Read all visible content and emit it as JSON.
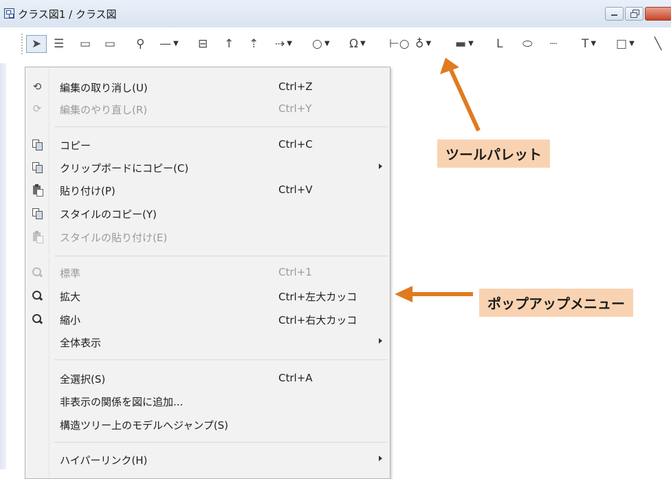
{
  "window": {
    "title": "クラス図1 / クラス図"
  },
  "toolbar": {
    "tools": [
      {
        "icon": "select-arrow-icon",
        "glyph": "➤"
      },
      {
        "icon": "class-icon",
        "glyph": "☰"
      },
      {
        "icon": "package-icon",
        "glyph": "▭"
      },
      {
        "icon": "subsystem-icon",
        "glyph": "▭"
      },
      {
        "icon": "pin-icon",
        "glyph": "⚲"
      },
      {
        "icon": "association-icon",
        "glyph": "—",
        "dropdown": true
      },
      {
        "icon": "association-class-icon",
        "glyph": "⊟"
      },
      {
        "icon": "generalization-icon",
        "glyph": "↑"
      },
      {
        "icon": "realization-icon",
        "glyph": "⇡"
      },
      {
        "icon": "dependency-icon",
        "glyph": "⇢",
        "dropdown": true
      },
      {
        "icon": "usage-icon",
        "glyph": "○",
        "dropdown": true
      },
      {
        "icon": "omega-icon",
        "glyph": "Ω",
        "dropdown": true
      },
      {
        "icon": "interface-icon",
        "glyph": "⊢○"
      },
      {
        "icon": "provided-interface-icon",
        "glyph": "♁",
        "dropdown": true
      },
      {
        "icon": "component-icon",
        "glyph": "▬",
        "dropdown": true
      },
      {
        "icon": "constraint-icon",
        "glyph": "L"
      },
      {
        "icon": "note-icon",
        "glyph": "⬭"
      },
      {
        "icon": "note-anchor-icon",
        "glyph": "┈"
      },
      {
        "icon": "text-icon",
        "glyph": "T",
        "dropdown": true
      },
      {
        "icon": "rectangle-icon",
        "glyph": "□",
        "dropdown": true
      },
      {
        "icon": "line-icon",
        "glyph": "╲"
      }
    ]
  },
  "menu": {
    "items": [
      {
        "label": "編集の取り消し(U)",
        "shortcut": "Ctrl+Z",
        "icon": "undo-icon",
        "enabled": true
      },
      {
        "label": "編集のやり直し(R)",
        "shortcut": "Ctrl+Y",
        "icon": "redo-icon",
        "enabled": false
      },
      {
        "label": "コピー",
        "shortcut": "Ctrl+C",
        "icon": "copy-icon",
        "enabled": true
      },
      {
        "label": "クリップボードにコピー(C)",
        "shortcut": "",
        "icon": "copy-clipboard-icon",
        "enabled": true,
        "submenu": true
      },
      {
        "label": "貼り付け(P)",
        "shortcut": "Ctrl+V",
        "icon": "paste-icon",
        "enabled": true
      },
      {
        "label": "スタイルのコピー(Y)",
        "shortcut": "",
        "icon": "copy-style-icon",
        "enabled": true
      },
      {
        "label": "スタイルの貼り付け(E)",
        "shortcut": "",
        "icon": "paste-style-icon",
        "enabled": false
      },
      {
        "label": "標準",
        "shortcut": "Ctrl+1",
        "icon": "zoom-normal-icon",
        "enabled": false
      },
      {
        "label": "拡大",
        "shortcut": "Ctrl+左大カッコ",
        "icon": "zoom-in-icon",
        "enabled": true
      },
      {
        "label": "縮小",
        "shortcut": "Ctrl+右大カッコ",
        "icon": "zoom-out-icon",
        "enabled": true
      },
      {
        "label": "全体表示",
        "shortcut": "",
        "icon": "",
        "enabled": true,
        "submenu": true
      },
      {
        "label": "全選択(S)",
        "shortcut": "Ctrl+A",
        "icon": "",
        "enabled": true
      },
      {
        "label": "非表示の関係を図に追加...",
        "shortcut": "",
        "icon": "",
        "enabled": true
      },
      {
        "label": "構造ツリー上のモデルへジャンプ(S)",
        "shortcut": "",
        "icon": "",
        "enabled": true
      },
      {
        "label": "ハイパーリンク(H)",
        "shortcut": "",
        "icon": "",
        "enabled": true,
        "submenu": true
      }
    ]
  },
  "callouts": {
    "tool_palette": "ツールパレット",
    "popup_menu": "ポップアップメニュー"
  },
  "colors": {
    "callout_bg": "#f9d3b1",
    "arrow": "#e07b1f"
  }
}
